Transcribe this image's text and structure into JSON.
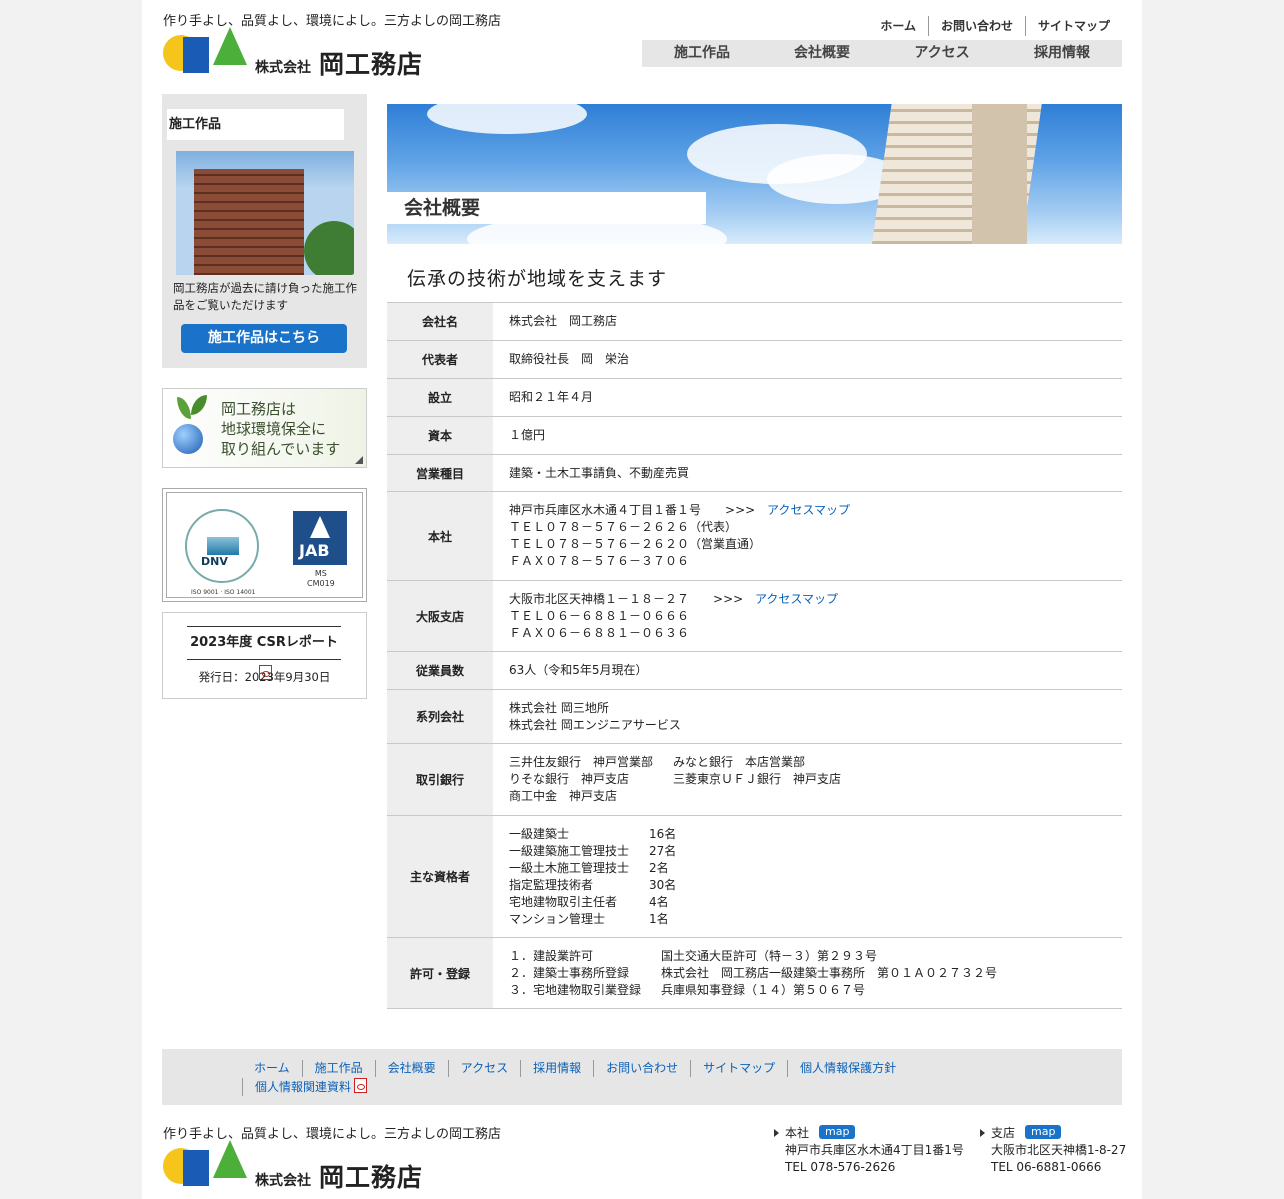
{
  "header": {
    "tagline": "作り手よし、品質よし、環境によし。三方よしの岡工務店",
    "logo_prefix": "株式会社",
    "logo_name": "岡工務店",
    "utility": [
      "ホーム",
      "お問い合わせ",
      "サイトマップ"
    ],
    "gnav": [
      "施工作品",
      "会社概要",
      "アクセス",
      "採用情報"
    ]
  },
  "sidebar": {
    "works_heading": "施工作品",
    "works_text": "岡工務店が過去に請け負った施工作品をご覧いただけます",
    "works_button": "施工作品はこちら",
    "eco_banner": [
      "岡工務店は",
      "地球環境保全に",
      "取り組んでいます"
    ],
    "cert": {
      "dnv_label": "DNV",
      "dnv_sub": "ISO 9001 · ISO 14001",
      "jab_label": "JAB",
      "jab_sub1": "MS",
      "jab_sub2": "CM019"
    },
    "csr_title": "2023年度 CSRレポート",
    "csr_date": "発行日：2023年9月30日"
  },
  "main": {
    "page_title": "会社概要",
    "lead": "伝承の技術が地域を支えます",
    "rows": [
      {
        "label": "会社名",
        "lines": [
          "株式会社　岡工務店"
        ]
      },
      {
        "label": "代表者",
        "lines": [
          "取締役社長　岡　栄治"
        ]
      },
      {
        "label": "設立",
        "lines": [
          "昭和２１年４月"
        ]
      },
      {
        "label": "資本",
        "lines": [
          "１億円"
        ]
      },
      {
        "label": "営業種目",
        "lines": [
          "建築・土木工事請負、不動産売買"
        ]
      },
      {
        "label": "本社",
        "lines": [
          "神戸市兵庫区水木通４丁目１番１号",
          "ＴＥＬ０７８－５７６－２６２６（代表）",
          "ＴＥＬ０７８－５７６－２６２０（営業直通）",
          "ＦＡＸ０７８－５７６－３７０６"
        ],
        "arrow": ">>>",
        "link": "アクセスマップ"
      },
      {
        "label": "大阪支店",
        "lines": [
          "大阪市北区天神橋１－１８－２７",
          "ＴＥＬ０６－６８８１－０６６６",
          "ＦＡＸ０６－６８８１－０６３６"
        ],
        "arrow": ">>>",
        "link": "アクセスマップ"
      },
      {
        "label": "従業員数",
        "lines": [
          "63人（令和5年5月現在）"
        ]
      },
      {
        "label": "系列会社",
        "lines": [
          "株式会社 岡三地所",
          "株式会社 岡エンジニアサービス"
        ]
      },
      {
        "label": "取引銀行",
        "lines": [
          "三井住友銀行　神戸営業部",
          "りそな銀行　神戸支店",
          "商工中金　神戸支店"
        ],
        "lines2": [
          "みなと銀行　本店営業部",
          "三菱東京ＵＦＪ銀行　神戸支店"
        ]
      },
      {
        "label": "主な資格者",
        "quals": [
          {
            "name": "一級建築士",
            "count": "16名"
          },
          {
            "name": "一級建築施工管理技士",
            "count": "27名"
          },
          {
            "name": "一級土木施工管理技士",
            "count": "2名"
          },
          {
            "name": "指定監理技術者",
            "count": "30名"
          },
          {
            "name": "宅地建物取引主任者",
            "count": "4名"
          },
          {
            "name": "マンション管理士",
            "count": "1名"
          }
        ]
      },
      {
        "label": "許可・登録",
        "perms": [
          {
            "name": "１．建設業許可",
            "value": "国土交通大臣許可（特－３）第２９３号"
          },
          {
            "name": "２．建築士事務所登録",
            "value": "株式会社　岡工務店一級建築士事務所　第０１Ａ０２７３２号"
          },
          {
            "name": "３．宅地建物取引業登録",
            "value": "兵庫県知事登録（１４）第５０６７号"
          }
        ]
      }
    ]
  },
  "footer": {
    "nav": [
      "ホーム",
      "施工作品",
      "会社概要",
      "アクセス",
      "採用情報",
      "お問い合わせ",
      "サイトマップ",
      "個人情報保護方針"
    ],
    "nav2": "個人情報関連資料",
    "tagline": "作り手よし、品質よし、環境によし。三方よしの岡工務店",
    "logo_prefix": "株式会社",
    "logo_name": "岡工務店",
    "map_label": "map",
    "hq": {
      "name": "本社",
      "address": "神戸市兵庫区水木通4丁目1番1号",
      "tel": "TEL 078-576-2626"
    },
    "branch": {
      "name": "支店",
      "address": "大阪市北区天神橋1-8-27",
      "tel": "TEL 06-6881-0666"
    }
  },
  "colors": {
    "accent": "#1b73c9",
    "panel": "#e6e6e6",
    "link": "#0b62b8"
  }
}
